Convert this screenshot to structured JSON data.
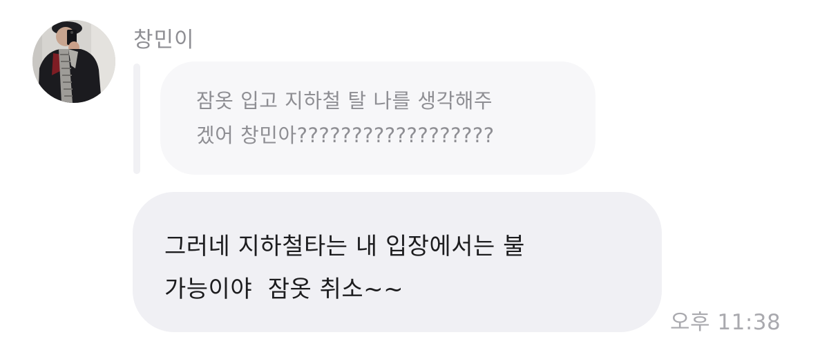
{
  "conversation": {
    "sender_name": "창민이",
    "avatar_icon": "profile-photo",
    "quoted_message": {
      "text": "잠옷 입고 지하철 탈 나를 생각해주\n겠어 창민아??????????????????"
    },
    "message": {
      "text": "그러네 지하철타는 내 입장에서는 불\n가능이야  잠옷 취소~~",
      "timestamp": "오후 11:38"
    }
  },
  "colors": {
    "quoted_bubble_bg": "#f7f7f9",
    "message_bubble_bg": "#f0f0f4",
    "secondary_text": "#8e8e93",
    "primary_text": "#1c1c1e"
  }
}
